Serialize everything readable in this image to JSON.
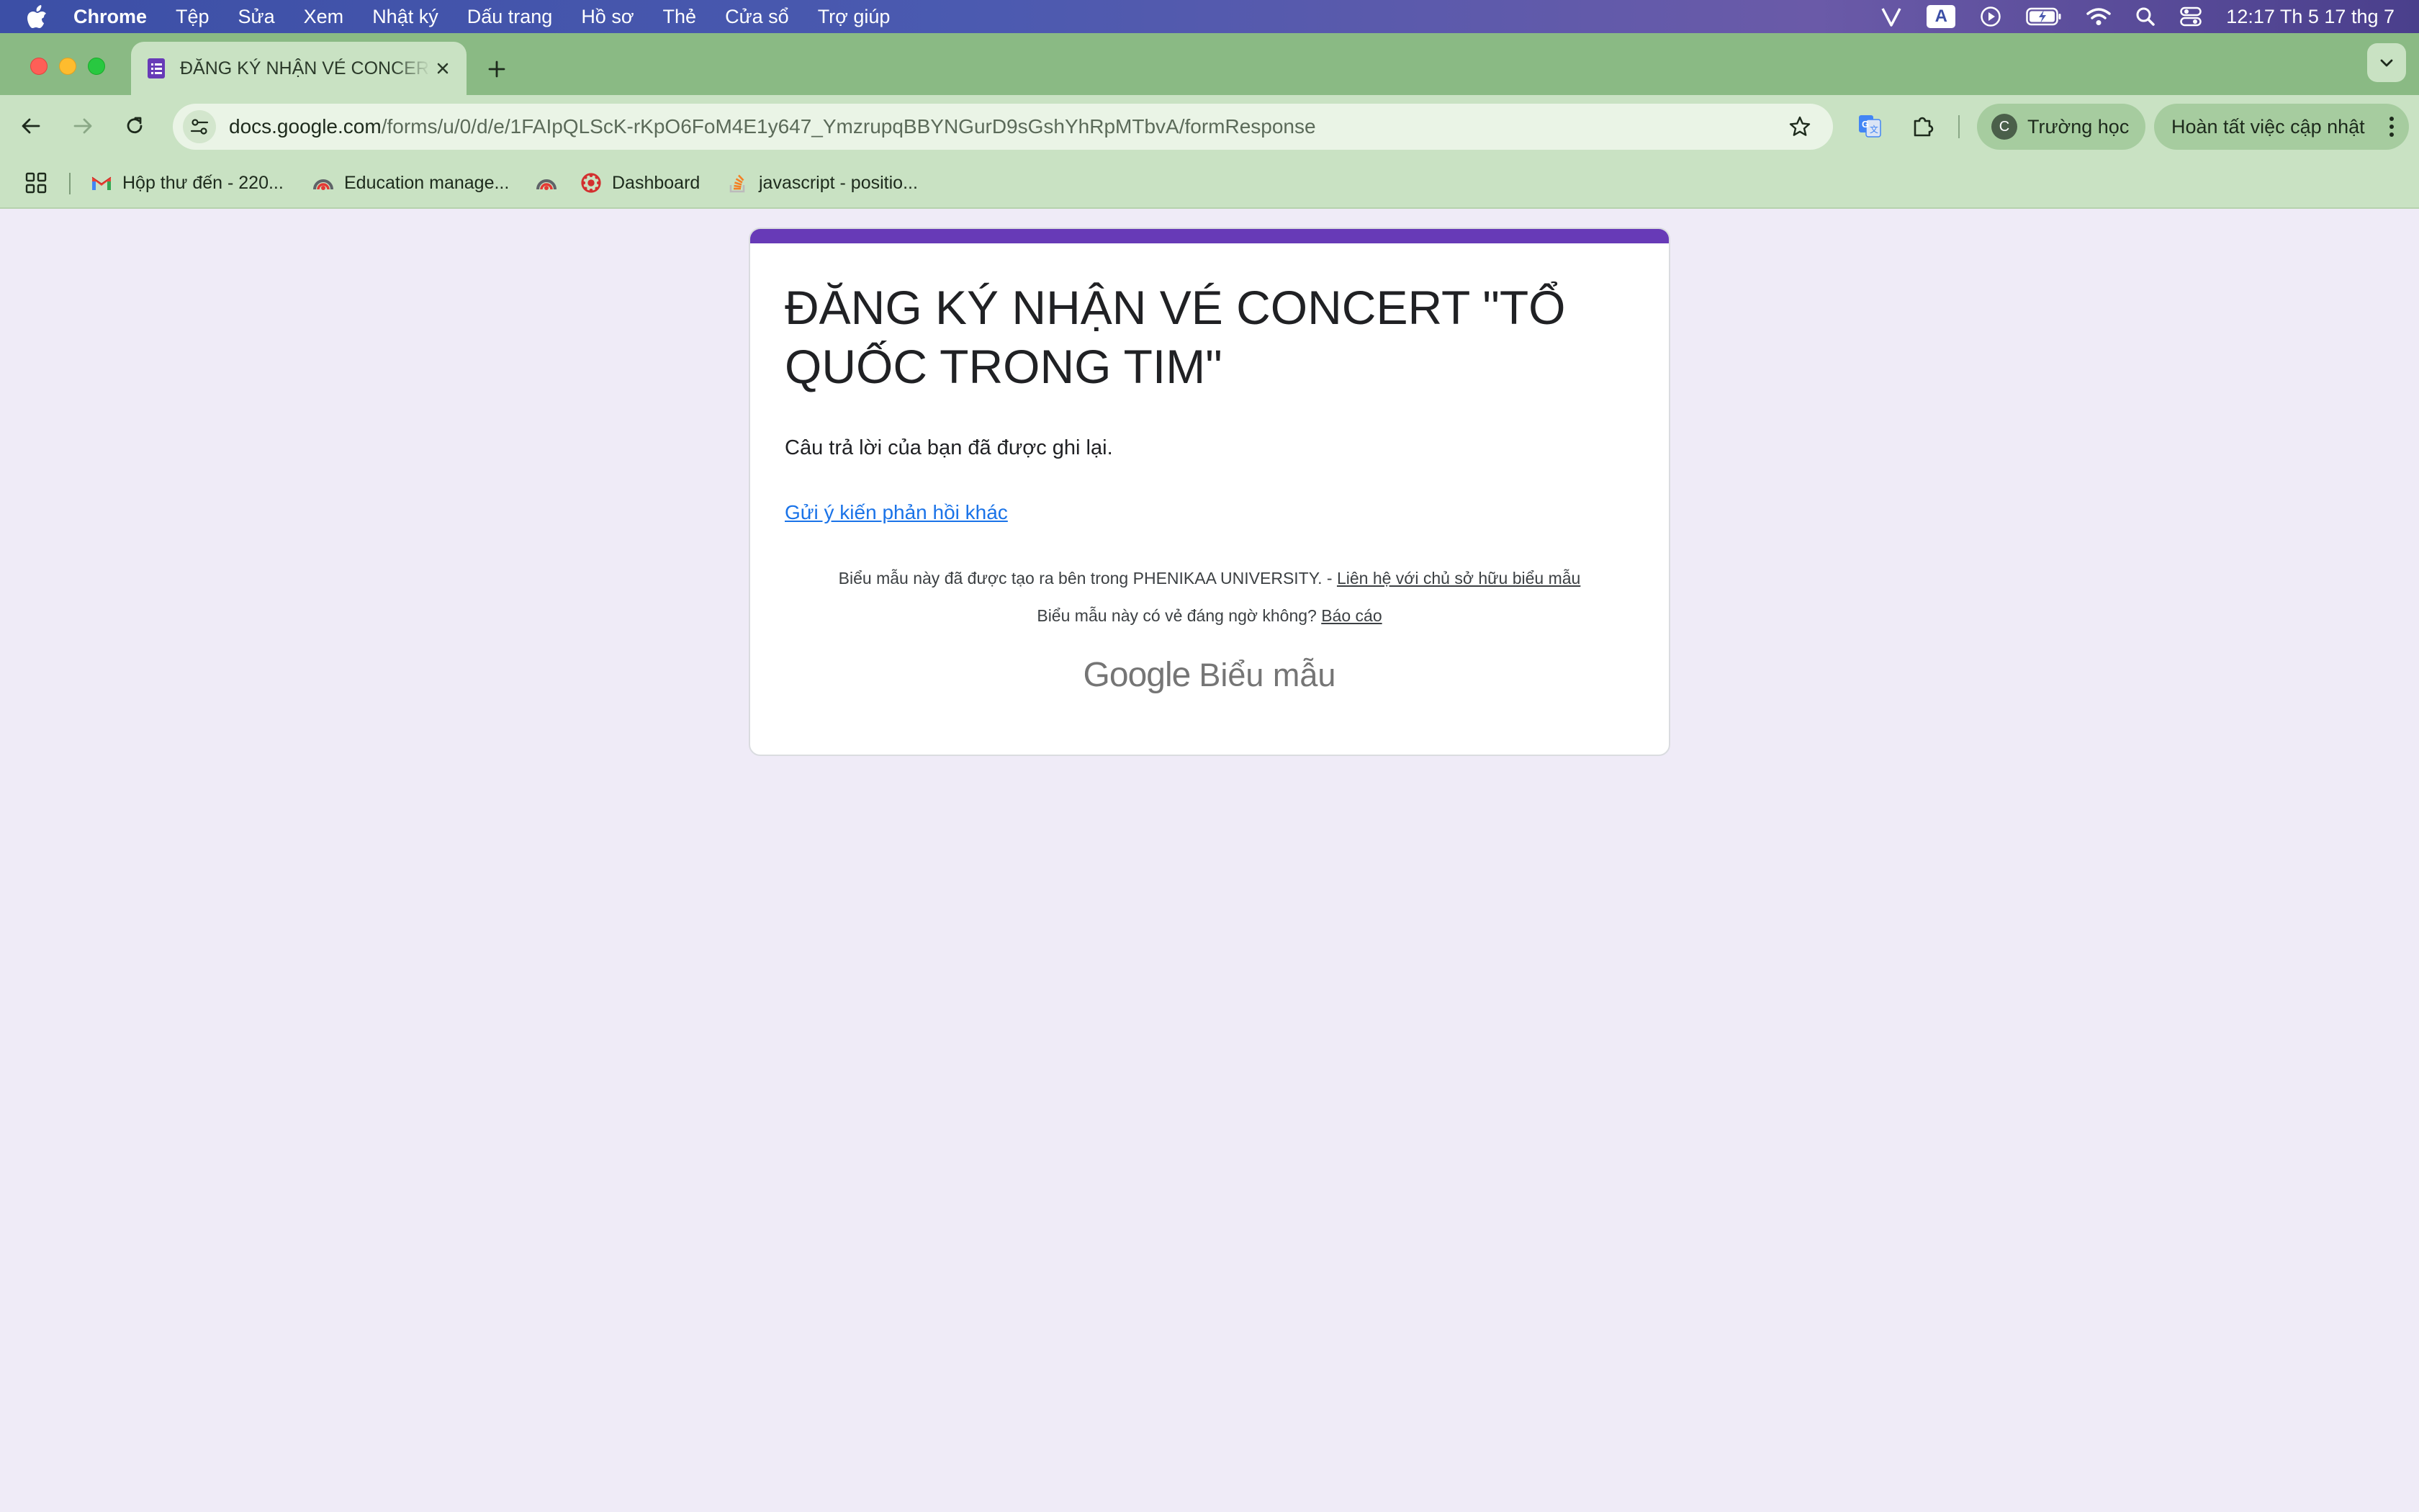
{
  "menubar": {
    "app": "Chrome",
    "items": [
      "Tệp",
      "Sửa",
      "Xem",
      "Nhật ký",
      "Dấu trang",
      "Hồ sơ",
      "Thẻ",
      "Cửa sổ",
      "Trợ giúp"
    ],
    "input_source": "A",
    "clock": "12:17 Th 5 17 thg 7"
  },
  "tab": {
    "title": "ĐĂNG KÝ NHẬN VÉ CONCERT \"TỔ QUỐC TRONG TIM\""
  },
  "toolbar": {
    "url_host": "docs.google.com",
    "url_path": "/forms/u/0/d/e/1FAIpQLScK-rKpO6FoM4E1y647_YmzrupqBBYNGurD9sGshYhRpMTbvA/formResponse",
    "profile_initial": "C",
    "profile_label": "Trường học",
    "update_label": "Hoàn tất việc cập nhật"
  },
  "bookmarks": [
    {
      "label": "Hộp thư đến - 220...",
      "icon": "gmail-icon"
    },
    {
      "label": "Education manage...",
      "icon": "edu-icon"
    },
    {
      "label": "",
      "icon": "edu-icon"
    },
    {
      "label": "Dashboard",
      "icon": "dashboard-icon"
    },
    {
      "label": "javascript - positio...",
      "icon": "stackoverflow-icon"
    }
  ],
  "form": {
    "title": "ĐĂNG KÝ NHẬN VÉ CONCERT \"TỔ QUỐC TRONG TIM\"",
    "confirmation": "Câu trả lời của bạn đã được ghi lại.",
    "another_response_link": "Gửi ý kiến phản hồi khác",
    "accent_color": "#673ab7"
  },
  "footer": {
    "created_text": "Biểu mẫu này đã được tạo ra bên trong PHENIKAA UNIVERSITY. -",
    "contact_link": "Liên hệ với chủ sở hữu biểu mẫu",
    "suspicious_text": "Biểu mẫu này có vẻ đáng ngờ không?",
    "report_link": "Báo cáo",
    "brand_google": "Google",
    "brand_forms": "Biểu mẫu"
  }
}
